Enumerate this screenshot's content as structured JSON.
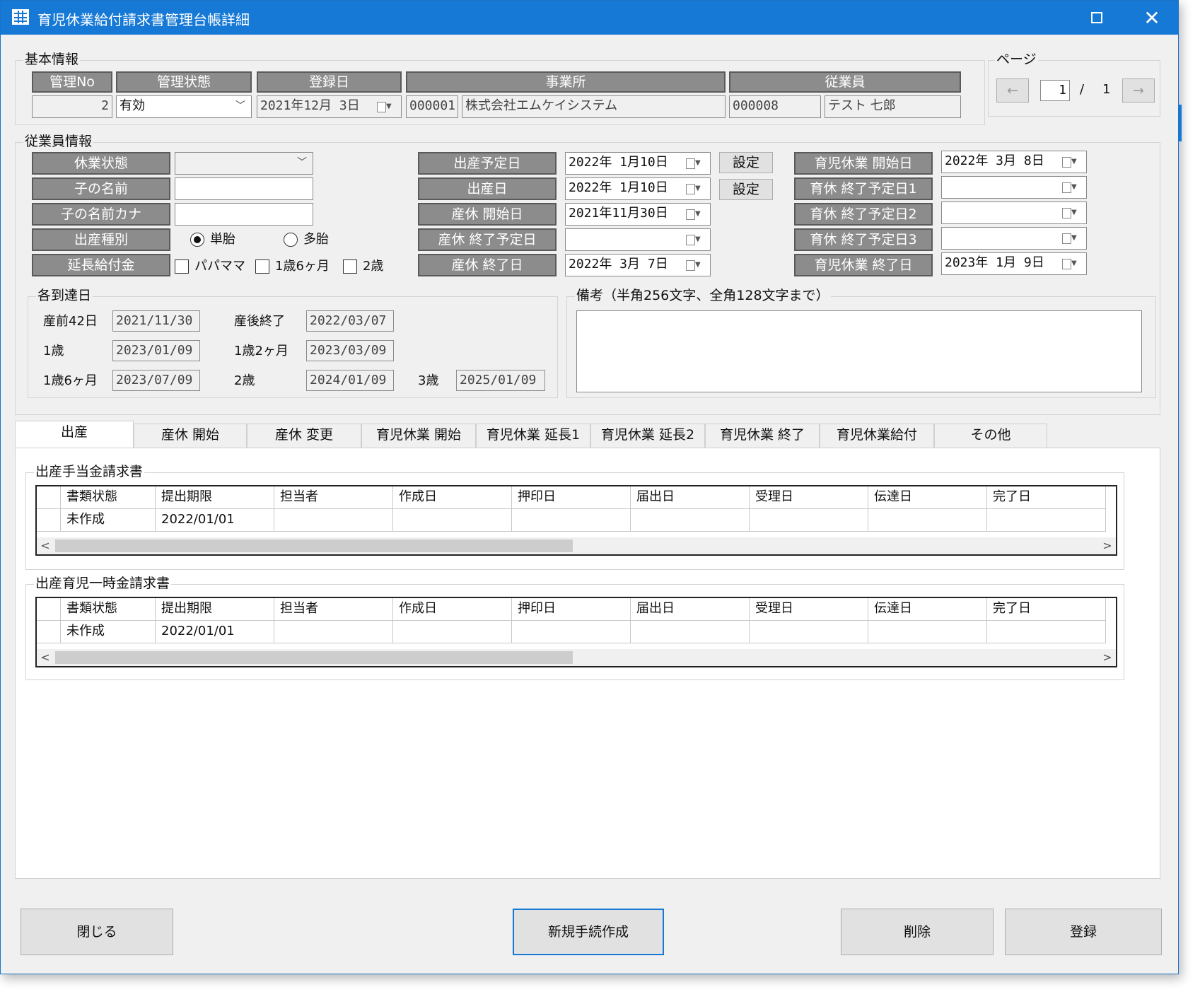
{
  "window": {
    "title": "育児休業給付請求書管理台帳詳細",
    "close_glyph": "✕"
  },
  "basic": {
    "legend": "基本情報",
    "headers": {
      "no": "管理No",
      "state": "管理状態",
      "reg": "登録日",
      "office": "事業所",
      "employee": "従業員"
    },
    "values": {
      "no": "2",
      "state": "有効",
      "reg": "2021年12月 3日",
      "office_code": "000001",
      "office_name": "株式会社エムケイシステム",
      "emp_code": "000008",
      "emp_name": "テスト 七郎"
    }
  },
  "page": {
    "legend": "ページ",
    "prev": "←",
    "current": "1",
    "sep": "/",
    "total": "1",
    "next": "→"
  },
  "emp": {
    "legend": "従業員情報",
    "labels": {
      "leave_state": "休業状態",
      "child_name": "子の名前",
      "child_kana": "子の名前カナ",
      "birth_type": "出産種別",
      "extension": "延長給付金",
      "due_date": "出産予定日",
      "birth_date": "出産日",
      "mat_start": "産休 開始日",
      "mat_end_plan": "産休 終了予定日",
      "mat_end": "産休 終了日",
      "ccl_start": "育児休業 開始日",
      "ccl_end_plan1": "育休 終了予定日1",
      "ccl_end_plan2": "育休 終了予定日2",
      "ccl_end_plan3": "育休 終了予定日3",
      "ccl_end": "育児休業 終了日"
    },
    "values": {
      "leave_state": "",
      "child_name": "",
      "child_kana": "",
      "due_date": "2022年 1月10日",
      "birth_date": "2022年 1月10日",
      "mat_start": "2021年11月30日",
      "mat_end_plan": "",
      "mat_end": "2022年 3月 7日",
      "ccl_start": "2022年 3月 8日",
      "ccl_end_plan1": "",
      "ccl_end_plan2": "",
      "ccl_end_plan3": "",
      "ccl_end": "2023年 1月 9日"
    },
    "set_button": "設定",
    "birth_type": {
      "single": "単胎",
      "multiple": "多胎",
      "selected": "single"
    },
    "extension": {
      "papa": "パパママ",
      "m18": "1歳6ヶ月",
      "y2": "2歳"
    }
  },
  "arrival": {
    "legend": "各到達日",
    "items": [
      {
        "label": "産前42日",
        "value": "2021/11/30"
      },
      {
        "label": "産後終了",
        "value": "2022/03/07"
      },
      {
        "label": "1歳",
        "value": "2023/01/09"
      },
      {
        "label": "1歳2ヶ月",
        "value": "2023/03/09"
      },
      {
        "label": "1歳6ヶ月",
        "value": "2023/07/09"
      },
      {
        "label": "2歳",
        "value": "2024/01/09"
      },
      {
        "label": "3歳",
        "value": "2025/01/09"
      }
    ]
  },
  "remarks": {
    "legend": "備考（半角256文字、全角128文字まで）",
    "value": ""
  },
  "tabs": [
    "出産",
    "産休 開始",
    "産休 変更",
    "育児休業 開始",
    "育児休業 延長1",
    "育児休業 延長2",
    "育児休業 終了",
    "育児休業給付",
    "その他"
  ],
  "grids": [
    {
      "legend": "出産手当金請求書",
      "columns": [
        "書類状態",
        "提出期限",
        "担当者",
        "作成日",
        "押印日",
        "届出日",
        "受理日",
        "伝達日",
        "完了日"
      ],
      "rows": [
        [
          "未作成",
          "2022/01/01",
          "",
          "",
          "",
          "",
          "",
          "",
          ""
        ]
      ]
    },
    {
      "legend": "出産育児一時金請求書",
      "columns": [
        "書類状態",
        "提出期限",
        "担当者",
        "作成日",
        "押印日",
        "届出日",
        "受理日",
        "伝達日",
        "完了日"
      ],
      "rows": [
        [
          "未作成",
          "2022/01/01",
          "",
          "",
          "",
          "",
          "",
          "",
          ""
        ]
      ]
    }
  ],
  "scroll": {
    "left": "<",
    "right": ">"
  },
  "buttons": {
    "close": "閉じる",
    "new": "新規手続作成",
    "delete": "削除",
    "register": "登録"
  },
  "colors": {
    "titlebar": "#1679d6",
    "header_gray": "#8c8c8c",
    "window_bg": "#f0f0f0"
  }
}
